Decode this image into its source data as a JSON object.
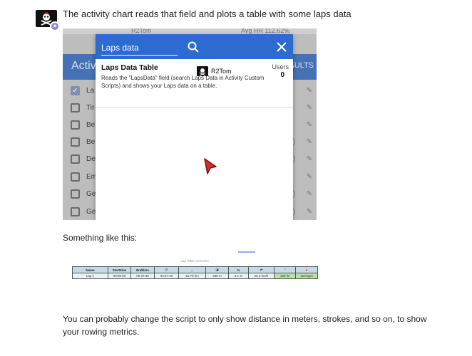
{
  "post": {
    "line1": "The activity chart reads that field and plots a table with some laps data",
    "line2": "Something like this:",
    "line3": "You can probably change the script to only show distance in meters, strokes, and so on, to show your rowing metrics."
  },
  "screenshot": {
    "top_strip_left": "R2Tom",
    "top_strip_right": "Avg HR 112.62%",
    "bg_header_title": "Activ",
    "bg_header_right": "AULTS",
    "bg_rows": [
      {
        "label": "La",
        "checked": true
      },
      {
        "label": "Tir",
        "checked": false
      },
      {
        "label": "Be",
        "checked": false
      },
      {
        "label": "Be",
        "checked": false
      },
      {
        "label": "De",
        "checked": false
      },
      {
        "label": "Em",
        "checked": false
      },
      {
        "label": "Ge",
        "checked": false
      },
      {
        "label": "Ge",
        "checked": false
      }
    ],
    "dialog": {
      "search_value": "Laps data",
      "search_icon": "search-icon",
      "close_icon": "close-icon",
      "item": {
        "title": "Laps Data Table",
        "description": "Reads the \"LapsData\" field (search Laps Data in Activity Custom Scripts) and shows your Laps data on a table.",
        "author": "R2Tom",
        "users_label": "Users",
        "users_value": "0"
      }
    }
  },
  "lap_table": {
    "title": "Lap Table Overview",
    "headers": [
      "Name",
      "Starttime",
      "Endtime",
      "◷",
      "↔",
      "◪",
      "%",
      "⇌",
      "♡",
      "♥"
    ],
    "rows": [
      [
        "Lap 1",
        "00:00:00",
        "00:37:40",
        "00:37:40",
        "15.78 km",
        "338 m",
        "3.1 %",
        "25.1 km/h",
        "190 W",
        "123 bpm"
      ]
    ]
  },
  "colors": {
    "dialog_bar": "#2e6bd1",
    "header_bg": "#c3dbe6",
    "highlight": "#b7e1a8",
    "badge": "#8d7fd8"
  }
}
